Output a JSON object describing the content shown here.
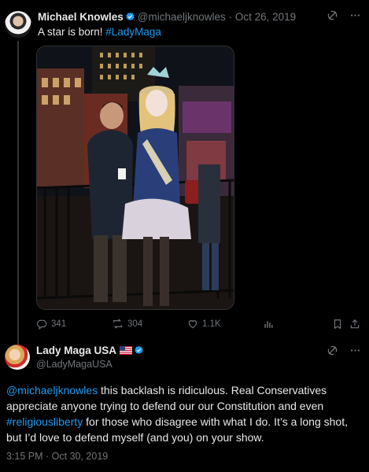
{
  "tweet1": {
    "author_name": "Michael Knowles",
    "author_handle": "@michaeljknowles",
    "separator": "·",
    "date": "Oct 26, 2019",
    "text_prefix": "A star is born! ",
    "hashtag": "#LadyMaga",
    "actions": {
      "replies": "341",
      "reposts": "304",
      "likes": "1.1K"
    }
  },
  "tweet2": {
    "author_name": "Lady Maga USA",
    "author_handle": "@LadyMagaUSA",
    "mention": "@michaeljknowles",
    "text_a": " this backlash is ridiculous. Real Conservatives appreciate anyone trying to defend our our Constitution and even ",
    "hashtag": "#religiousliberty",
    "text_b": " for those who disagree with what I do. It’s a long shot, but I’d love to defend myself (and you) on your show.",
    "timestamp": "3:15 PM · Oct 30, 2019"
  },
  "colors": {
    "background": "#000000",
    "text": "#e7e9ea",
    "muted": "#71767b",
    "link": "#1d9bf0",
    "verified": "#1d9bf0"
  }
}
